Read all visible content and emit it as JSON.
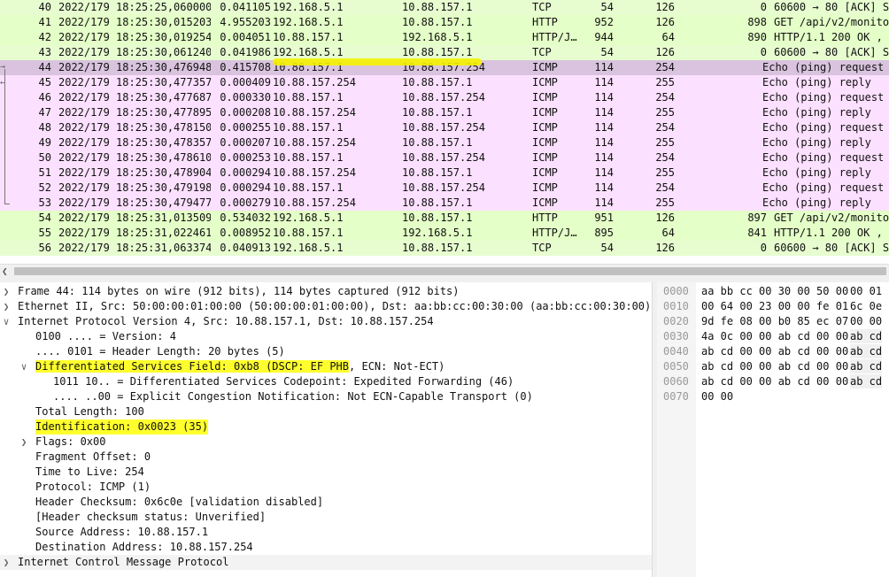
{
  "packet_list": {
    "rows": [
      {
        "no": "40",
        "time": "2022/179 18:25:25,060000",
        "delta": "0.041105",
        "src": "192.168.5.1",
        "dst": "10.88.157.1",
        "proto": "TCP",
        "len": "54",
        "x": "126",
        "info_num": "0",
        "info": "60600 → 80 [ACK] Seq=",
        "kind": "tcp"
      },
      {
        "no": "41",
        "time": "2022/179 18:25:30,015203",
        "delta": "4.955203",
        "src": "192.168.5.1",
        "dst": "10.88.157.1",
        "proto": "HTTP",
        "len": "952",
        "x": "126",
        "info_num": "898",
        "info": "GET /api/v2/monitor/s",
        "kind": "http"
      },
      {
        "no": "42",
        "time": "2022/179 18:25:30,019254",
        "delta": "0.004051",
        "src": "10.88.157.1",
        "dst": "192.168.5.1",
        "proto": "HTTP/J…",
        "len": "944",
        "x": "64",
        "info_num": "890",
        "info": "HTTP/1.1 200 OK , Jav",
        "kind": "http"
      },
      {
        "no": "43",
        "time": "2022/179 18:25:30,061240",
        "delta": "0.041986",
        "src": "192.168.5.1",
        "dst": "10.88.157.1",
        "proto": "TCP",
        "len": "54",
        "x": "126",
        "info_num": "0",
        "info": "60600 → 80 [ACK] Seq=",
        "kind": "tcp"
      },
      {
        "no": "44",
        "time": "2022/179 18:25:30,476948",
        "delta": "0.415708",
        "src": "10.88.157.1",
        "dst": "10.88.157.254",
        "proto": "ICMP",
        "len": "114",
        "x": "254",
        "info_num": "",
        "info": "Echo (ping) request",
        "kind": "selected"
      },
      {
        "no": "45",
        "time": "2022/179 18:25:30,477357",
        "delta": "0.000409",
        "src": "10.88.157.254",
        "dst": "10.88.157.1",
        "proto": "ICMP",
        "len": "114",
        "x": "255",
        "info_num": "",
        "info": "Echo (ping) reply",
        "kind": "icmp"
      },
      {
        "no": "46",
        "time": "2022/179 18:25:30,477687",
        "delta": "0.000330",
        "src": "10.88.157.1",
        "dst": "10.88.157.254",
        "proto": "ICMP",
        "len": "114",
        "x": "254",
        "info_num": "",
        "info": "Echo (ping) request",
        "kind": "icmp"
      },
      {
        "no": "47",
        "time": "2022/179 18:25:30,477895",
        "delta": "0.000208",
        "src": "10.88.157.254",
        "dst": "10.88.157.1",
        "proto": "ICMP",
        "len": "114",
        "x": "255",
        "info_num": "",
        "info": "Echo (ping) reply",
        "kind": "icmp"
      },
      {
        "no": "48",
        "time": "2022/179 18:25:30,478150",
        "delta": "0.000255",
        "src": "10.88.157.1",
        "dst": "10.88.157.254",
        "proto": "ICMP",
        "len": "114",
        "x": "254",
        "info_num": "",
        "info": "Echo (ping) request",
        "kind": "icmp"
      },
      {
        "no": "49",
        "time": "2022/179 18:25:30,478357",
        "delta": "0.000207",
        "src": "10.88.157.254",
        "dst": "10.88.157.1",
        "proto": "ICMP",
        "len": "114",
        "x": "255",
        "info_num": "",
        "info": "Echo (ping) reply",
        "kind": "icmp"
      },
      {
        "no": "50",
        "time": "2022/179 18:25:30,478610",
        "delta": "0.000253",
        "src": "10.88.157.1",
        "dst": "10.88.157.254",
        "proto": "ICMP",
        "len": "114",
        "x": "254",
        "info_num": "",
        "info": "Echo (ping) request",
        "kind": "icmp"
      },
      {
        "no": "51",
        "time": "2022/179 18:25:30,478904",
        "delta": "0.000294",
        "src": "10.88.157.254",
        "dst": "10.88.157.1",
        "proto": "ICMP",
        "len": "114",
        "x": "255",
        "info_num": "",
        "info": "Echo (ping) reply",
        "kind": "icmp"
      },
      {
        "no": "52",
        "time": "2022/179 18:25:30,479198",
        "delta": "0.000294",
        "src": "10.88.157.1",
        "dst": "10.88.157.254",
        "proto": "ICMP",
        "len": "114",
        "x": "254",
        "info_num": "",
        "info": "Echo (ping) request",
        "kind": "icmp"
      },
      {
        "no": "53",
        "time": "2022/179 18:25:30,479477",
        "delta": "0.000279",
        "src": "10.88.157.254",
        "dst": "10.88.157.1",
        "proto": "ICMP",
        "len": "114",
        "x": "255",
        "info_num": "",
        "info": "Echo (ping) reply",
        "kind": "icmp"
      },
      {
        "no": "54",
        "time": "2022/179 18:25:31,013509",
        "delta": "0.534032",
        "src": "192.168.5.1",
        "dst": "10.88.157.1",
        "proto": "HTTP",
        "len": "951",
        "x": "126",
        "info_num": "897",
        "info": "GET /api/v2/monitor/s",
        "kind": "http"
      },
      {
        "no": "55",
        "time": "2022/179 18:25:31,022461",
        "delta": "0.008952",
        "src": "10.88.157.1",
        "dst": "192.168.5.1",
        "proto": "HTTP/J…",
        "len": "895",
        "x": "64",
        "info_num": "841",
        "info": "HTTP/1.1 200 OK , Jav",
        "kind": "http"
      },
      {
        "no": "56",
        "time": "2022/179 18:25:31,063374",
        "delta": "0.040913",
        "src": "192.168.5.1",
        "dst": "10.88.157.1",
        "proto": "TCP",
        "len": "54",
        "x": "126",
        "info_num": "0",
        "info": "60600 → 80 [ACK] Seq=",
        "kind": "tcp"
      }
    ]
  },
  "details": {
    "frame": "Frame 44: 114 bytes on wire (912 bits), 114 bytes captured (912 bits)",
    "ethernet": "Ethernet II, Src: 50:00:00:01:00:00 (50:00:00:01:00:00), Dst: aa:bb:cc:00:30:00 (aa:bb:cc:00:30:00)",
    "ipv4": "Internet Protocol Version 4, Src: 10.88.157.1, Dst: 10.88.157.254",
    "version": "0100 .... = Version: 4",
    "header_length": ".... 0101 = Header Length: 20 bytes (5)",
    "dsfield_a": "Differentiated Services Field: 0xb8 (DSCP: EF PHB",
    "dsfield_b": ", ECN: Not-ECT)",
    "dscp": "1011 10.. = Differentiated Services Codepoint: Expedited Forwarding (46)",
    "ecn": ".... ..00 = Explicit Congestion Notification: Not ECN-Capable Transport (0)",
    "total_length": "Total Length: 100",
    "identification": "Identification: 0x0023 (35)",
    "flags": "Flags: 0x00",
    "fragment_offset": "Fragment Offset: 0",
    "ttl": "Time to Live: 254",
    "protocol": "Protocol: ICMP (1)",
    "checksum": "Header Checksum: 0x6c0e [validation disabled]",
    "checksum_status": "[Header checksum status: Unverified]",
    "source": "Source Address: 10.88.157.1",
    "destination": "Destination Address: 10.88.157.254",
    "icmp": "Internet Control Message Protocol"
  },
  "hex": {
    "rows": [
      {
        "off": "0000",
        "b1": "aa bb cc 00 30 00 50 00",
        "b2": "00 01"
      },
      {
        "off": "0010",
        "b1": "00 64 00 23 00 00 fe 01",
        "b2": "6c 0e"
      },
      {
        "off": "0020",
        "b1": "9d fe 08 00 b0 85 ec 07",
        "b2": "00 00"
      },
      {
        "off": "0030",
        "b1": "4a 0c 00 00 ab cd 00 00",
        "b2": "ab cd"
      },
      {
        "off": "0040",
        "b1": "ab cd 00 00 ab cd 00 00",
        "b2": "ab cd"
      },
      {
        "off": "0050",
        "b1": "ab cd 00 00 ab cd 00 00",
        "b2": "ab cd"
      },
      {
        "off": "0060",
        "b1": "ab cd 00 00 ab cd 00 00",
        "b2": "ab cd"
      },
      {
        "off": "0070",
        "b1": "00 00",
        "b2": ""
      }
    ]
  },
  "colors": {
    "tcp_row": "#e7fdd0",
    "http_row": "#e4ffc7",
    "icmp_row": "#fce0ff",
    "selected_row": "#d9c3de",
    "highlight": "#ffff2e"
  }
}
